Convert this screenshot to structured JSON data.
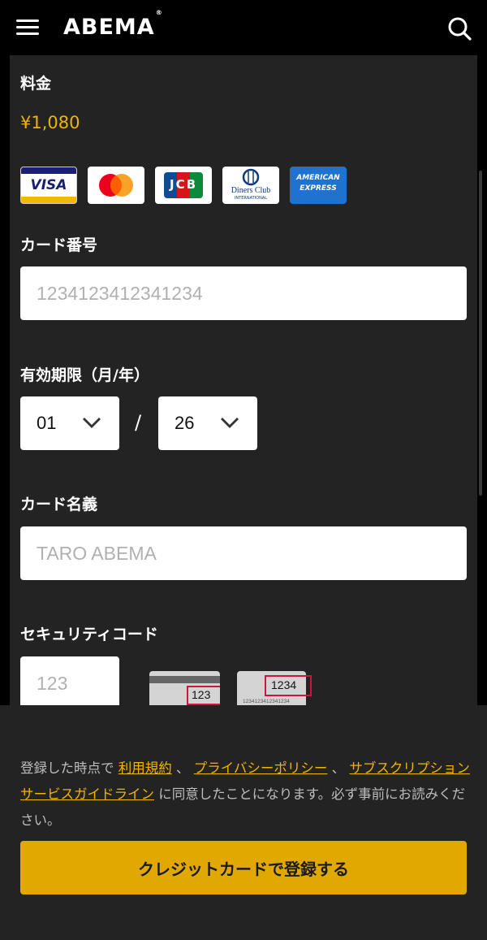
{
  "header": {
    "logo": "ABEMA",
    "logo_mark": "®"
  },
  "price": {
    "label": "料金",
    "value": "¥1,080"
  },
  "cards": {
    "visa": "VISA",
    "jcb": "JCB",
    "diners_line1": "Diners Club",
    "diners_line2": "INTERNATIONAL",
    "amex_line1": "AMERICAN",
    "amex_line2": "EXPRESS"
  },
  "card_number": {
    "label": "カード番号",
    "placeholder": "1234123412341234"
  },
  "expiry": {
    "label": "有効期限（月/年）",
    "month": "01",
    "separator": "/",
    "year": "26"
  },
  "card_name": {
    "label": "カード名義",
    "placeholder": "TARO ABEMA"
  },
  "security": {
    "label": "セキュリティコード",
    "placeholder": "123",
    "example_back_code": "123",
    "example_front_code": "1234",
    "example_front_number": "1234123412341234"
  },
  "terms": {
    "prefix": "登録した時点で",
    "link1": "利用規約",
    "sep1": "、",
    "link2": "プライバシーポリシー",
    "sep2": "、",
    "link3": "サブスクリプションサービスガイドライン",
    "suffix": "に同意したことになります。必ず事前にお読みください。"
  },
  "submit_label": "クレジットカードで登録する",
  "colors": {
    "accent": "#f0b400",
    "button": "#e0a800",
    "panel": "#232323"
  }
}
